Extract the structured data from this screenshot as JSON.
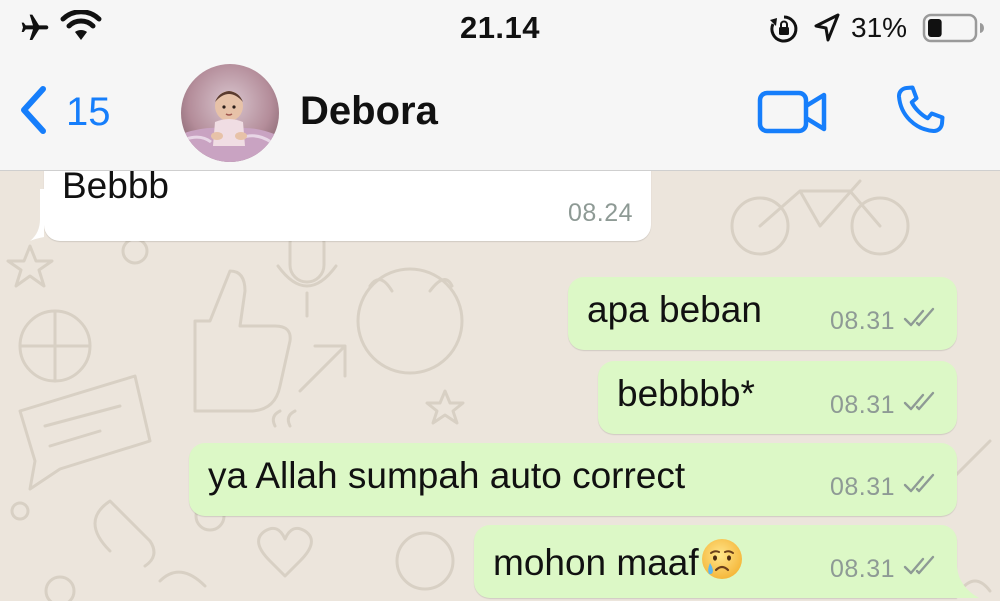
{
  "status_bar": {
    "time": "21.14",
    "battery_percent": "31%",
    "battery_level": 0.31,
    "icons": [
      "airplane-icon",
      "wifi-icon",
      "rotation-lock-icon",
      "location-icon",
      "battery-icon"
    ]
  },
  "header": {
    "back_count": "15",
    "contact_name": "Debora",
    "icons": [
      "chevron-left-icon",
      "video-camera-icon",
      "phone-icon"
    ],
    "accent_color": "#167efb"
  },
  "messages": [
    {
      "direction": "incoming",
      "text": "Bebbb",
      "time": "08.24"
    },
    {
      "direction": "outgoing",
      "text": "apa beban",
      "time": "08.31",
      "status": "double-check"
    },
    {
      "direction": "outgoing",
      "text": "bebbbb*",
      "time": "08.31",
      "status": "double-check"
    },
    {
      "direction": "outgoing",
      "text": "ya Allah sumpah auto correct",
      "time": "08.31",
      "status": "double-check"
    },
    {
      "direction": "outgoing",
      "text": "mohon maaf",
      "emoji": "crying-face",
      "time": "08.31",
      "status": "double-check"
    }
  ],
  "colors": {
    "incoming_bubble": "#ffffff",
    "outgoing_bubble": "#dcf8c6",
    "chat_background": "#ece5dc",
    "timestamp": "#8e9a95"
  }
}
